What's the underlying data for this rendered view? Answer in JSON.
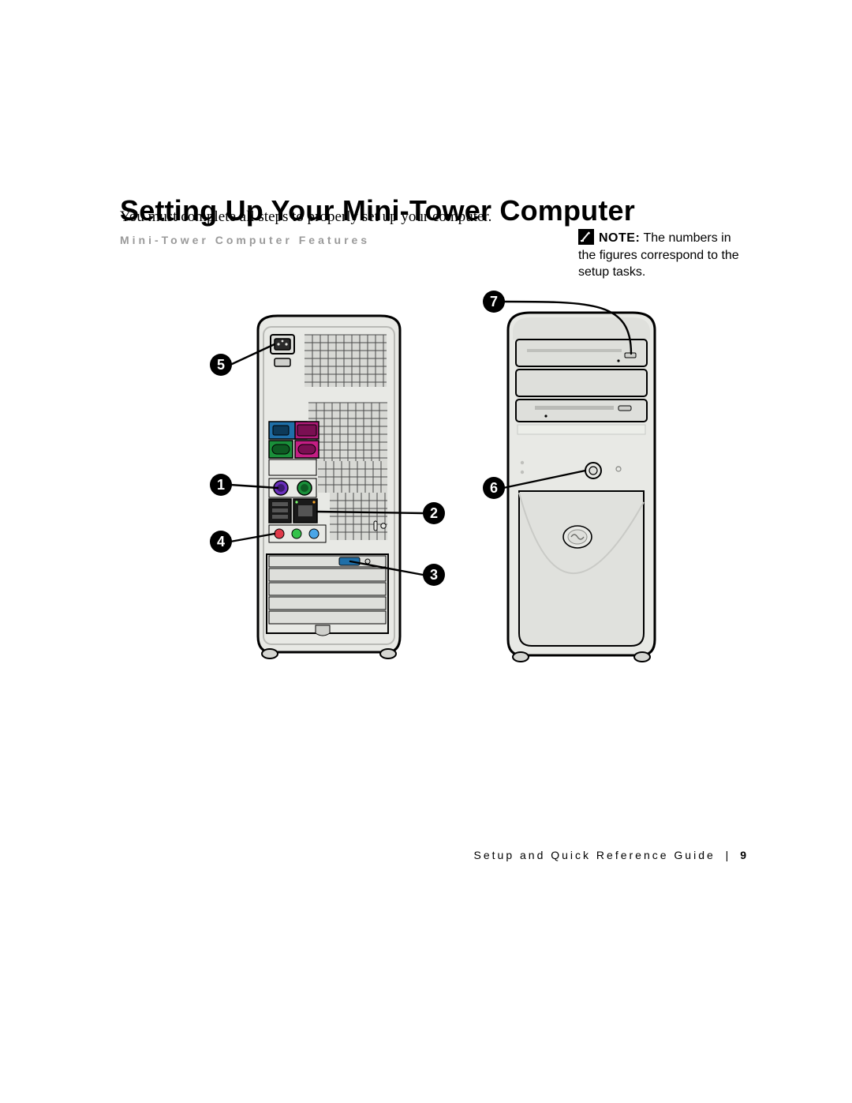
{
  "title": "Setting Up Your Mini-Tower Computer",
  "intro": "You must complete all steps to properly set up your computer.",
  "subhead": "Mini-Tower Computer Features",
  "note": {
    "label": "NOTE:",
    "text": " The numbers in the figures correspond to the setup tasks."
  },
  "callouts": {
    "c1": "1",
    "c2": "2",
    "c3": "3",
    "c4": "4",
    "c5": "5",
    "c6": "6",
    "c7": "7"
  },
  "footer": {
    "book": "Setup and Quick Reference Guide",
    "sep": "|",
    "page": "9"
  }
}
